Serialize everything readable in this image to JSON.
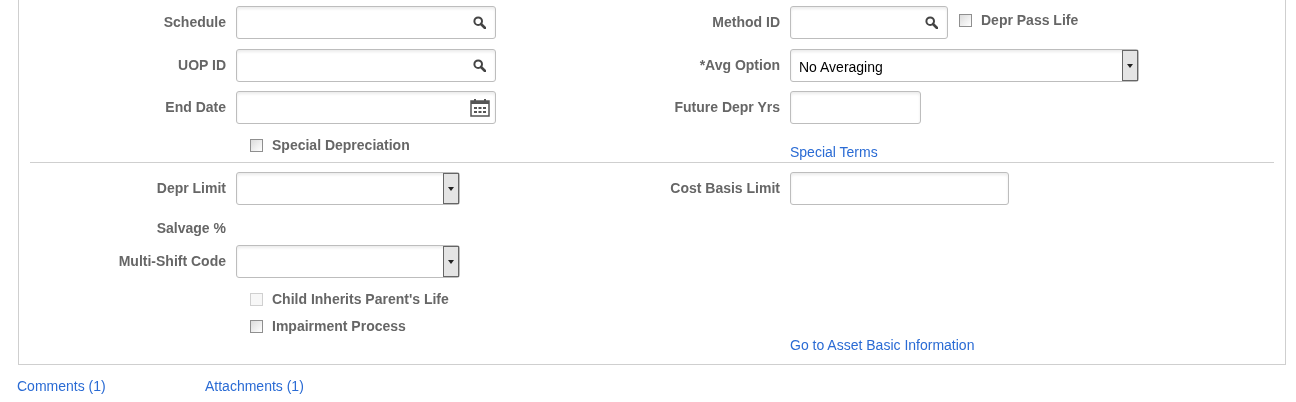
{
  "sections": [
    {
      "left": [
        {
          "kind": "lookup",
          "label": "Schedule"
        },
        {
          "kind": "lookup",
          "label": "UOP ID"
        },
        {
          "kind": "date",
          "label": "End Date"
        },
        {
          "kind": "checkbox",
          "label": "Special Depreciation",
          "checked": false,
          "disabled": false
        }
      ],
      "right": [
        {
          "kind": "lookup",
          "label": "Method ID",
          "checkbox": {
            "label": "Depr Pass Life",
            "checked": false,
            "disabled": false
          }
        },
        {
          "kind": "select",
          "label": "*Avg Option",
          "value": "No Averaging"
        },
        {
          "kind": "text",
          "label": "Future Depr Yrs"
        },
        {
          "kind": "link",
          "label": "Special Terms"
        }
      ]
    },
    {
      "left": [
        {
          "kind": "select",
          "label": "Depr Limit"
        },
        {
          "kind": "label",
          "label": "Salvage %"
        },
        {
          "kind": "select",
          "label": "Multi-Shift Code"
        },
        {
          "kind": "checkbox",
          "label": "Child Inherits Parent's Life",
          "checked": false,
          "disabled": true
        },
        {
          "kind": "checkbox",
          "label": "Impairment Process",
          "checked": false,
          "disabled": false
        }
      ],
      "right": [
        {
          "kind": "text",
          "label": "Cost Basis Limit"
        },
        {
          "kind": "link",
          "label": "Go to Asset Basic Information"
        }
      ]
    }
  ],
  "footer_links": [
    "Comments (1)",
    "Attachments (1)"
  ]
}
